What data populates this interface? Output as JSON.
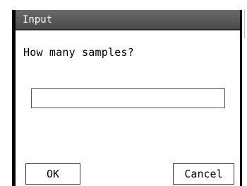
{
  "dialog": {
    "title": "Input",
    "prompt": "How many samples?",
    "input": {
      "value": "",
      "placeholder": ""
    },
    "buttons": {
      "ok_label": "OK",
      "cancel_label": "Cancel"
    }
  },
  "colors": {
    "titlebar": "#555555",
    "frame": "#000000",
    "background": "#ffffff"
  }
}
